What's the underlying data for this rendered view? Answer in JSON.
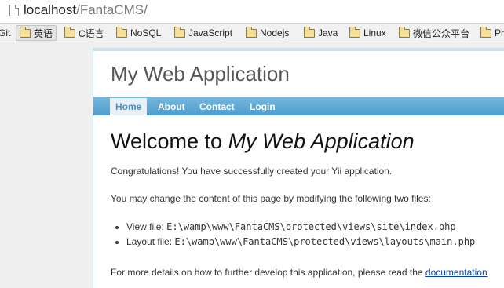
{
  "browser": {
    "url_host": "localhost",
    "url_path": "/FantaCMS/"
  },
  "bookmarks": {
    "items": [
      {
        "label": "Git",
        "folder": false
      },
      {
        "label": "英语",
        "folder": true,
        "active": true
      },
      {
        "label": "C语言",
        "folder": true
      },
      {
        "label": "NoSQL",
        "folder": true
      },
      {
        "label": "JavaScript",
        "folder": true
      },
      {
        "label": "Nodejs",
        "folder": true
      },
      {
        "label": "Java",
        "folder": true
      },
      {
        "label": "Linux",
        "folder": true
      },
      {
        "label": "微信公众平台",
        "folder": true
      },
      {
        "label": "Ph",
        "folder": true
      }
    ]
  },
  "site": {
    "title": "My Web Application",
    "menu": [
      {
        "label": "Home",
        "active": true
      },
      {
        "label": "About"
      },
      {
        "label": "Contact"
      },
      {
        "label": "Login"
      }
    ]
  },
  "content": {
    "heading_prefix": "Welcome to ",
    "heading_app": "My Web Application",
    "congrats": "Congratulations! You have successfully created your Yii application.",
    "change_text": "You may change the content of this page by modifying the following two files:",
    "files": [
      {
        "label": "View file: ",
        "path": "E:\\wamp\\www\\FantaCMS\\protected\\views\\site\\index.php"
      },
      {
        "label": "Layout file: ",
        "path": "E:\\wamp\\www\\FantaCMS\\protected\\views\\layouts\\main.php"
      }
    ],
    "more_prefix": "For more details on how to further develop this application, please read the ",
    "more_link": "documentation"
  },
  "colors": {
    "menubar": "#5fa8d4",
    "link": "#0645ad"
  }
}
